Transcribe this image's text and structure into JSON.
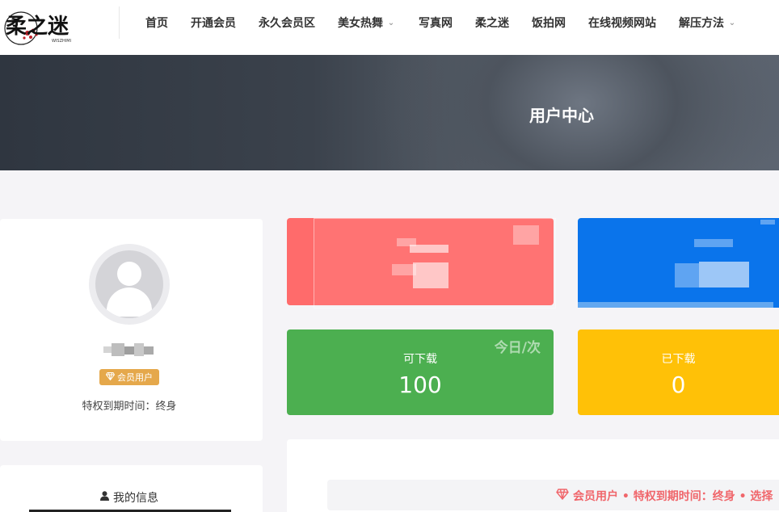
{
  "logo": {
    "text": "柔之迷",
    "subtext": "WISZHIMI"
  },
  "nav": {
    "items": [
      {
        "label": "首页",
        "dropdown": false
      },
      {
        "label": "开通会员",
        "dropdown": false
      },
      {
        "label": "永久会员区",
        "dropdown": false
      },
      {
        "label": "美女热舞",
        "dropdown": true
      },
      {
        "label": "写真网",
        "dropdown": false
      },
      {
        "label": "柔之迷",
        "dropdown": false
      },
      {
        "label": "饭拍网",
        "dropdown": false
      },
      {
        "label": "在线视频网站",
        "dropdown": false
      },
      {
        "label": "解压方法",
        "dropdown": true
      }
    ]
  },
  "banner": {
    "title": "用户中心"
  },
  "profile": {
    "avatar_icon": "user-avatar-icon",
    "badge_label": "会员用户",
    "expire_label": "特权到期时间：终身"
  },
  "info_card": {
    "title": "我的信息"
  },
  "stats": {
    "download_label": "可下载",
    "download_value": "100",
    "download_unit": "今日/次",
    "downloaded_label": "已下载",
    "downloaded_value": "0"
  },
  "notice": {
    "text": "会员用户 • 特权到期时间：终身 • 选择"
  },
  "colors": {
    "red": "#ff6b6b",
    "blue": "#0a74eb",
    "green": "#4caf50",
    "yellow": "#ffc107",
    "badge": "#e5a84b",
    "notice": "#f0666b"
  }
}
